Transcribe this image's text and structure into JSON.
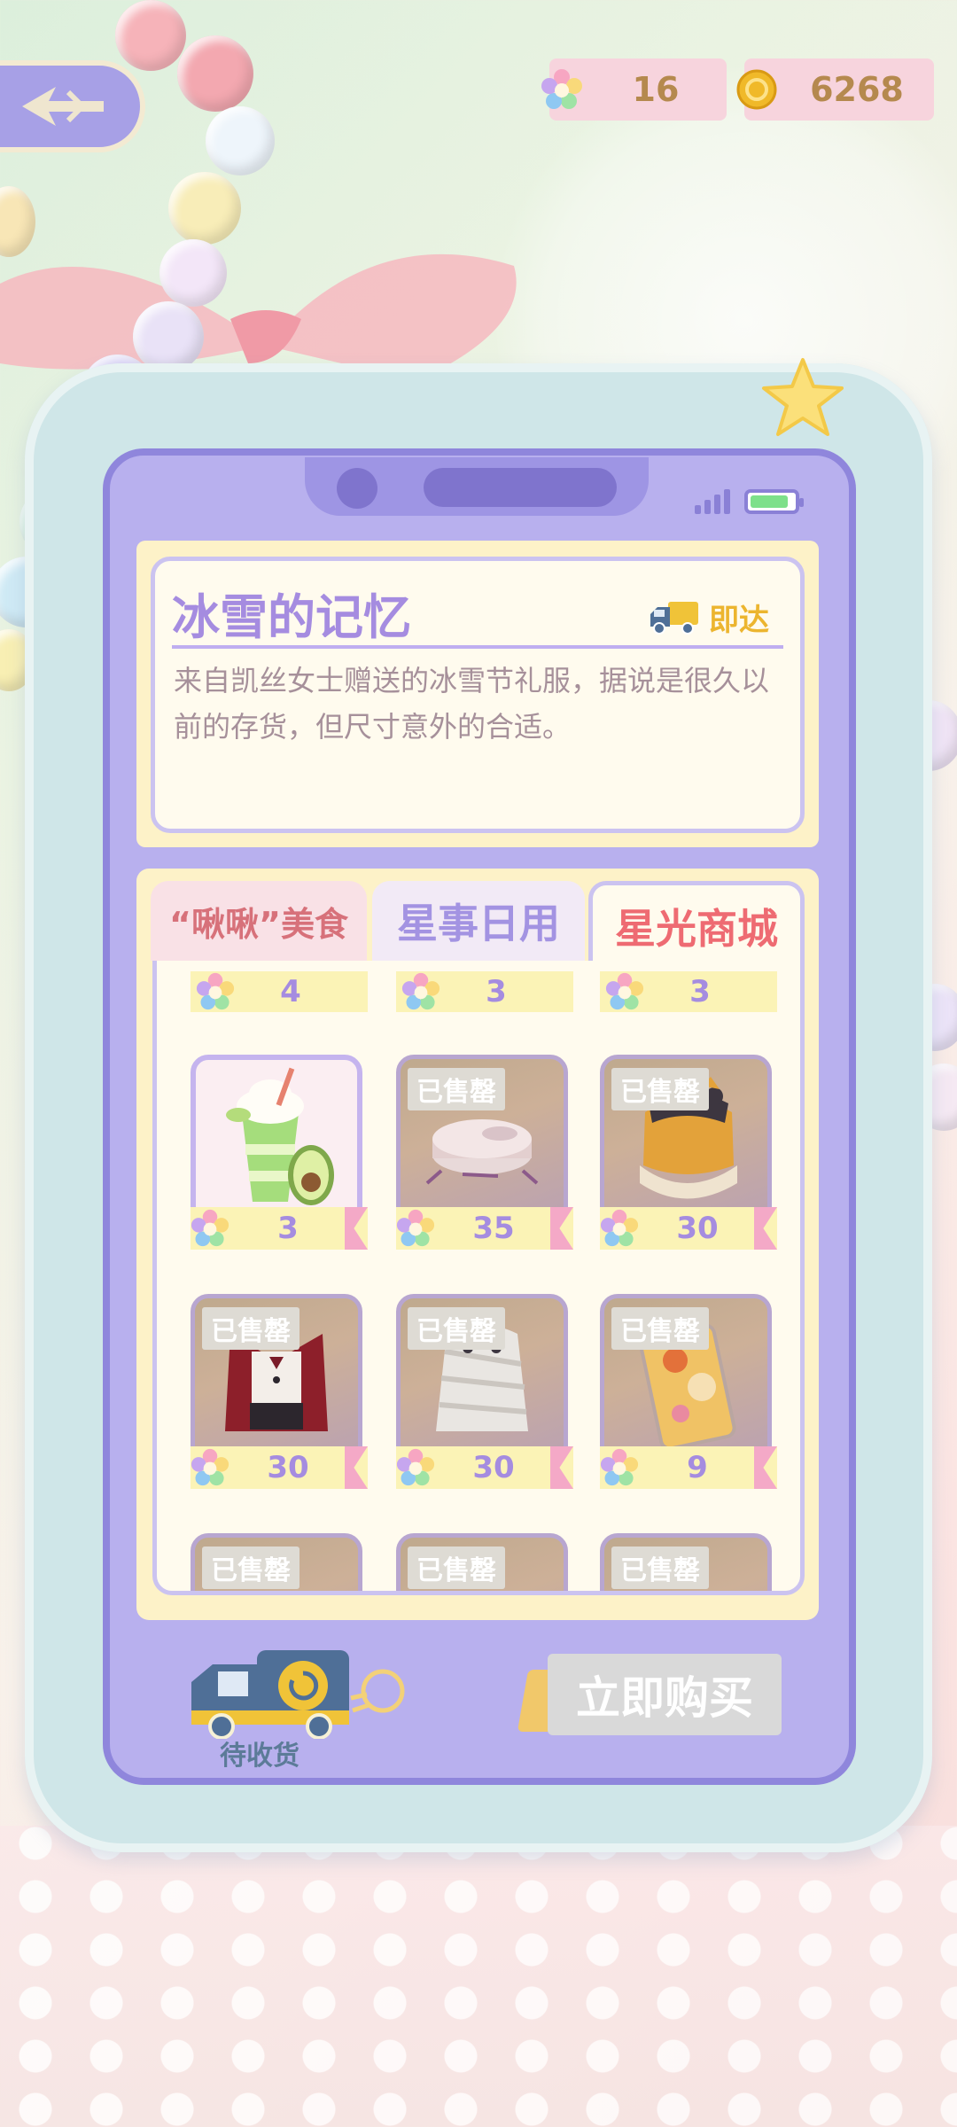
{
  "header": {
    "star_count": "16",
    "coin_count": "6268"
  },
  "info": {
    "title": "冰雪的记忆",
    "delivery_label": "即达",
    "description": "来自凯丝女士赠送的冰雪节礼服，据说是很久以前的存货，但尺寸意外的合适。"
  },
  "tabs": [
    {
      "label": "“啾啾”美食"
    },
    {
      "label": "星事日用"
    },
    {
      "label": "星光商城"
    }
  ],
  "top_row_prices": [
    "4",
    "3",
    "3"
  ],
  "items": [
    {
      "name": "avocado-smoothie",
      "price": "3",
      "sold": false,
      "sold_label": ""
    },
    {
      "name": "robot-vacuum",
      "price": "35",
      "sold": true,
      "sold_label": "已售罄"
    },
    {
      "name": "cat-bed",
      "price": "30",
      "sold": true,
      "sold_label": "已售罄"
    },
    {
      "name": "vampire-costume",
      "price": "30",
      "sold": true,
      "sold_label": "已售罄"
    },
    {
      "name": "mummy-costume",
      "price": "30",
      "sold": true,
      "sold_label": "已售罄"
    },
    {
      "name": "phone-case",
      "price": "9",
      "sold": true,
      "sold_label": "已售罄"
    }
  ],
  "partial_row_labels": [
    "已售罄",
    "已售罄",
    "已售罄"
  ],
  "bottom": {
    "truck_label": "待收货",
    "buy_label": "立即购买"
  }
}
